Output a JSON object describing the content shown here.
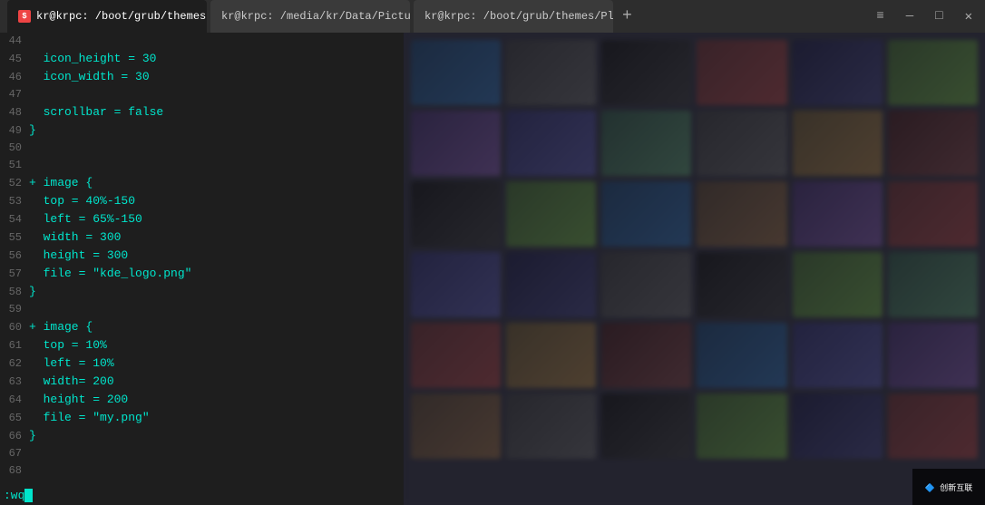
{
  "titlebar": {
    "tabs": [
      {
        "id": "tab1",
        "label": "kr@krpc: /boot/grub/themes/Plas",
        "active": false,
        "has_icon": true
      },
      {
        "id": "tab2",
        "label": "kr@krpc: /media/kr/Data/Pictu",
        "active": false,
        "has_icon": false
      },
      {
        "id": "tab3",
        "label": "kr@krpc: /boot/grub/themes/Plas",
        "active": true,
        "has_icon": false
      }
    ],
    "add_tab_label": "+",
    "btn_minimize": "—",
    "btn_maximize": "□",
    "btn_close": "✕",
    "btn_menu": "≡"
  },
  "editor": {
    "lines": [
      {
        "num": "44",
        "content": ""
      },
      {
        "num": "45",
        "content": "  icon_height = 30"
      },
      {
        "num": "46",
        "content": "  icon_width = 30"
      },
      {
        "num": "47",
        "content": ""
      },
      {
        "num": "48",
        "content": "  scrollbar = false"
      },
      {
        "num": "49",
        "content": "}"
      },
      {
        "num": "50",
        "content": ""
      },
      {
        "num": "51",
        "content": ""
      },
      {
        "num": "52",
        "content": "+ image {"
      },
      {
        "num": "53",
        "content": "  top = 40%-150"
      },
      {
        "num": "54",
        "content": "  left = 65%-150"
      },
      {
        "num": "55",
        "content": "  width = 300"
      },
      {
        "num": "56",
        "content": "  height = 300"
      },
      {
        "num": "57",
        "content": "  file = \"kde_logo.png\""
      },
      {
        "num": "58",
        "content": "}"
      },
      {
        "num": "59",
        "content": ""
      },
      {
        "num": "60",
        "content": "+ image {"
      },
      {
        "num": "61",
        "content": "  top = 10%"
      },
      {
        "num": "62",
        "content": "  left = 10%"
      },
      {
        "num": "63",
        "content": "  width= 200"
      },
      {
        "num": "64",
        "content": "  height = 200"
      },
      {
        "num": "65",
        "content": "  file = \"my.png\""
      },
      {
        "num": "66",
        "content": "}"
      },
      {
        "num": "67",
        "content": ""
      },
      {
        "num": "68",
        "content": ""
      }
    ],
    "cmd_line": ":wq"
  },
  "filebrowser": {
    "thumbs": [
      "t1",
      "t4",
      "t7",
      "t3",
      "t11",
      "t2",
      "t8",
      "t5",
      "t9",
      "t4",
      "t6",
      "t12",
      "t7",
      "t2",
      "t1",
      "t10",
      "t8",
      "t3",
      "t5",
      "t11",
      "t4",
      "t7",
      "t2",
      "t9",
      "t3",
      "t6",
      "t12",
      "t1",
      "t5",
      "t8",
      "t10",
      "t4",
      "t7",
      "t2",
      "t11",
      "t3"
    ]
  },
  "watermark": {
    "line1": "创新互联",
    "line2": ""
  }
}
